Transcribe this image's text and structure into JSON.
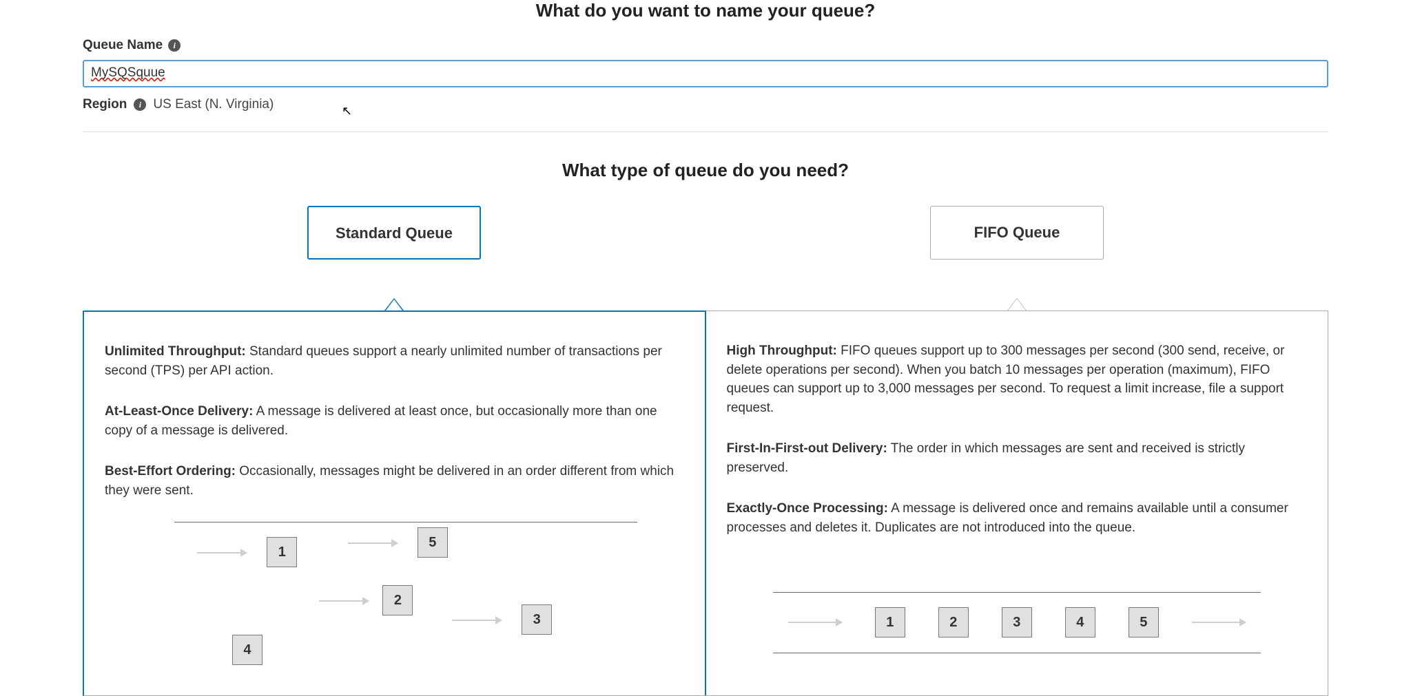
{
  "headings": {
    "name_q": "What do you want to name your queue?",
    "type_q": "What type of queue do you need?"
  },
  "labels": {
    "queue_name": "Queue Name",
    "region": "Region"
  },
  "fields": {
    "queue_name_value": "MySQSquue",
    "region_value": "US East (N. Virginia)"
  },
  "queue_types": {
    "standard_label": "Standard Queue",
    "fifo_label": "FIFO Queue",
    "selected": "standard"
  },
  "standard_features": {
    "f1_title": "Unlimited Throughput:",
    "f1_body": " Standard queues support a nearly unlimited number of transactions per second (TPS) per API action.",
    "f2_title": "At-Least-Once Delivery:",
    "f2_body": " A message is delivered at least once, but occasionally more than one copy of a message is delivered.",
    "f3_title": "Best-Effort Ordering:",
    "f3_body": " Occasionally, messages might be delivered in an order different from which they were sent."
  },
  "fifo_features": {
    "f1_title": "High Throughput:",
    "f1_body": " FIFO queues support up to 300 messages per second (300 send, receive, or delete operations per second). When you batch 10 messages per operation (maximum), FIFO queues can support up to 3,000 messages per second. To request a limit increase, file a support request.",
    "f2_title": "First-In-First-out Delivery:",
    "f2_body": " The order in which messages are sent and received is strictly preserved.",
    "f3_title": "Exactly-Once Processing:",
    "f3_body": " A message is delivered once and remains available until a consumer processes and deletes it. Duplicates are not introduced into the queue."
  },
  "diagram": {
    "standard_order": [
      "1",
      "5",
      "2",
      "3",
      "4"
    ],
    "fifo_order": [
      "1",
      "2",
      "3",
      "4",
      "5"
    ]
  }
}
